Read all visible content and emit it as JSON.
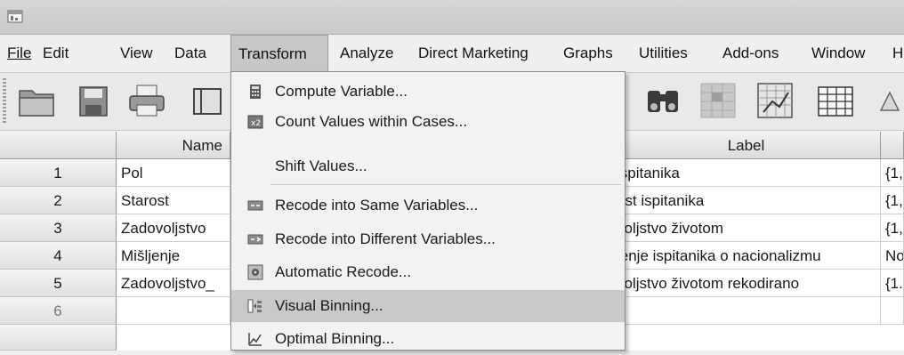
{
  "menubar": {
    "file": "File",
    "edit": "Edit",
    "view": "View",
    "data": "Data",
    "transform": "Transform",
    "analyze": "Analyze",
    "direct_marketing": "Direct Marketing",
    "graphs": "Graphs",
    "utilities": "Utilities",
    "addons": "Add-ons",
    "window": "Window",
    "help": "H"
  },
  "toolbar": {
    "icons": [
      "open-folder-icon",
      "save-icon",
      "print-icon",
      "data-view-icon",
      "find-icon",
      "insert-cases-icon",
      "chart-builder-icon",
      "value-labels-icon",
      "scale-icon"
    ]
  },
  "grid": {
    "headers": {
      "name": "Name",
      "label": "Label"
    },
    "rows": [
      {
        "num": "1",
        "name": "Pol",
        "label": "ispitanika",
        "values": "{1,"
      },
      {
        "num": "2",
        "name": "Starost",
        "label": "ost ispitanika",
        "values": "{1,"
      },
      {
        "num": "3",
        "name": "Zadovoljstvo",
        "label": "voljstvo životom",
        "values": "{1,"
      },
      {
        "num": "4",
        "name": "Mišljenje",
        "label": "jenje ispitanika o nacionalizmu",
        "values": "No"
      },
      {
        "num": "5",
        "name": "Zadovoljstvo_",
        "label": "voljstvo životom rekodirano",
        "values": "{1."
      },
      {
        "num": "6",
        "name": "",
        "label": "",
        "values": ""
      }
    ]
  },
  "transform_menu": {
    "compute_variable": "Compute Variable...",
    "count_values": "Count Values within Cases...",
    "shift_values": "Shift Values...",
    "recode_same": "Recode into Same Variables...",
    "recode_different": "Recode into Different Variables...",
    "automatic_recode": "Automatic Recode...",
    "visual_binning": "Visual Binning...",
    "optimal_binning": "Optimal Binning...",
    "highlighted_item": "Visual Binning...",
    "highlight_color": "#c9c9c9"
  }
}
